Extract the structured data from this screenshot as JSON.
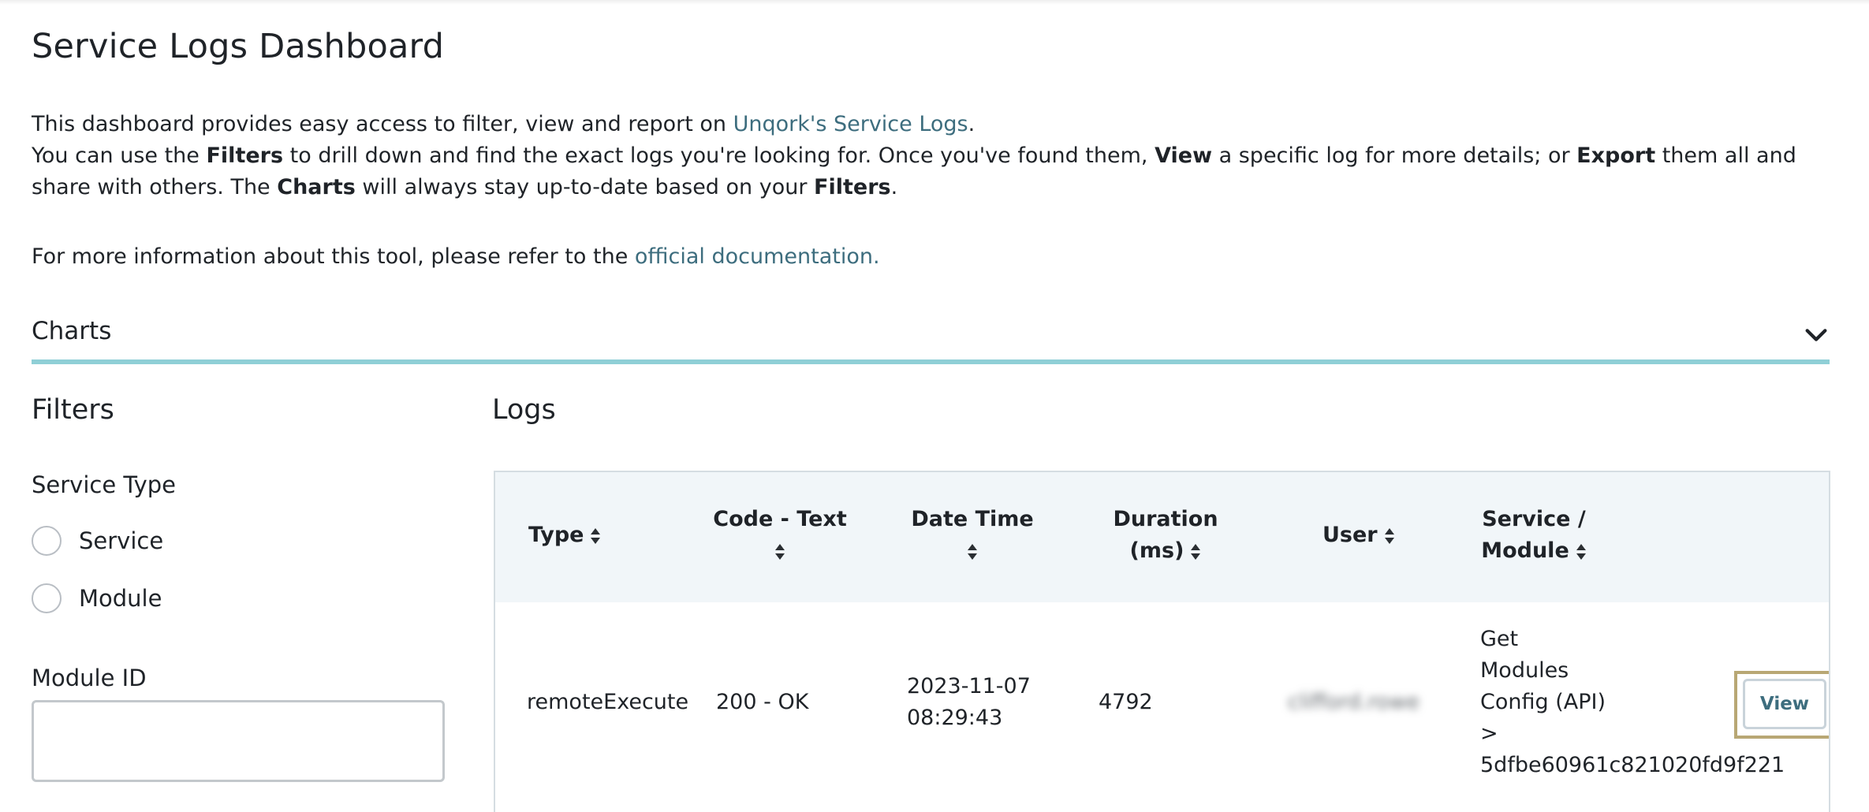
{
  "page": {
    "title": "Service Logs Dashboard"
  },
  "intro": {
    "line1_pre": "This dashboard provides easy access to filter, view and report on ",
    "line1_link": "Unqork's Service Logs",
    "line1_post": ".",
    "line2_a": "You can use the ",
    "line2_b": "Filters",
    "line2_c": " to drill down and find the exact logs you're looking for. Once you've found them, ",
    "line2_d": "View",
    "line2_e": " a specific log for more details; or ",
    "line2_f": "Export",
    "line2_g": " them all and share with others. The ",
    "line2_h": "Charts",
    "line2_i": " will always stay up-to-date based on your ",
    "line2_j": "Filters",
    "line2_k": ".",
    "line3_pre": "For more information about this tool, please refer to the ",
    "line3_link": "official documentation."
  },
  "charts": {
    "title": "Charts",
    "icon": "chevron-down-icon"
  },
  "filters": {
    "title": "Filters",
    "service_type_label": "Service Type",
    "options": [
      "Service",
      "Module"
    ],
    "module_id_label": "Module ID",
    "module_id_value": ""
  },
  "logs": {
    "title": "Logs",
    "columns": [
      {
        "line1": "Type",
        "line2": ""
      },
      {
        "line1": "Code - Text",
        "line2": ""
      },
      {
        "line1": "Date Time",
        "line2": ""
      },
      {
        "line1": "Duration",
        "line2": "(ms)"
      },
      {
        "line1": "User",
        "line2": ""
      },
      {
        "line1": "Service /",
        "line2": "Module"
      }
    ],
    "rows": [
      {
        "type": "remoteExecute",
        "code_text": "200 - OK",
        "date": "2023-11-07",
        "time": "08:29:43",
        "duration": "4792",
        "user": "clifford.rowe",
        "service_lines": [
          "Get",
          "Modules",
          "Config (API)",
          ">",
          "5dfbe60961c821020fd9f221"
        ],
        "action": "View"
      }
    ]
  },
  "colors": {
    "link": "#3d6d7e",
    "accent_rule": "#8fcfd6",
    "table_header_bg": "#f1f6f9",
    "focus_ring": "#b8a774"
  }
}
